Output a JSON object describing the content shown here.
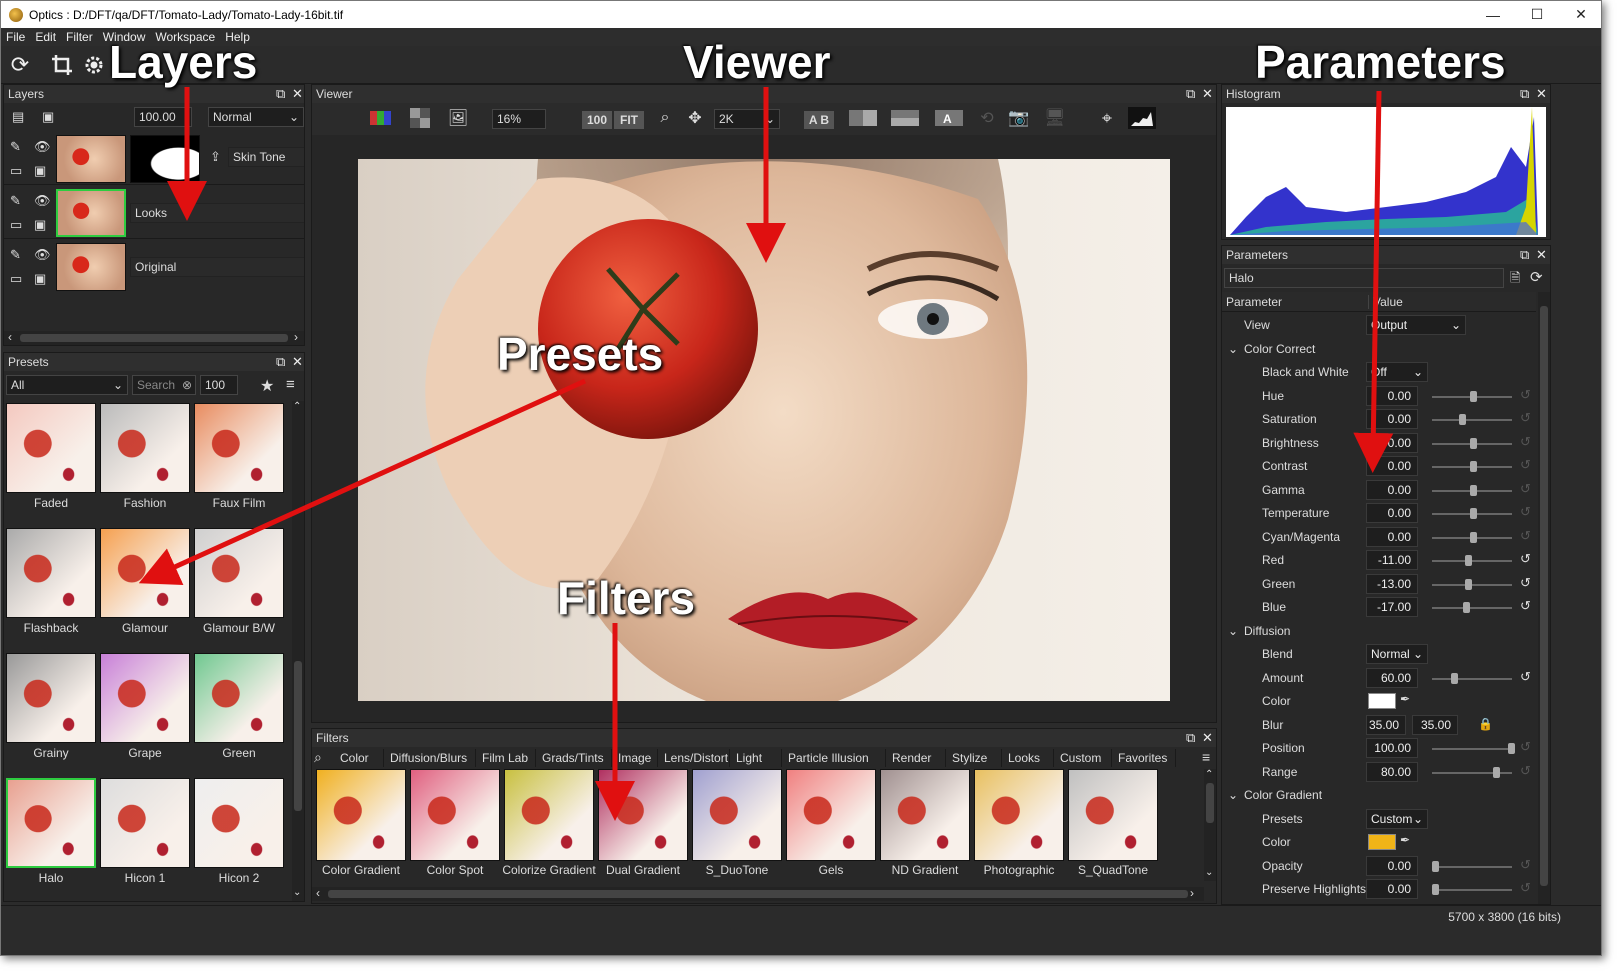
{
  "window": {
    "title": "Optics : D:/DFT/qa/DFT/Tomato-Lady/Tomato-Lady-16bit.tif"
  },
  "menu": [
    "File",
    "Edit",
    "Filter",
    "Window",
    "Workspace",
    "Help"
  ],
  "annotations": {
    "layers": "Layers",
    "viewer": "Viewer",
    "parameters": "Parameters",
    "presets": "Presets",
    "filters": "Filters"
  },
  "layers": {
    "title": "Layers",
    "opacity": "100.00",
    "blend_mode": "Normal",
    "items": [
      {
        "name": "Skin Tone",
        "selected": false
      },
      {
        "name": "Looks",
        "selected": true
      },
      {
        "name": "Original",
        "selected": false
      }
    ]
  },
  "presets": {
    "title": "Presets",
    "category": "All",
    "search_placeholder": "Search",
    "size": "100",
    "items": [
      "Faded",
      "Fashion",
      "Faux Film",
      "Flashback",
      "Glamour",
      "Glamour B/W",
      "Grainy",
      "Grape",
      "Green",
      "Halo",
      "Hicon 1",
      "Hicon 2"
    ],
    "selected": "Halo"
  },
  "viewer": {
    "title": "Viewer",
    "zoom": "16%",
    "btn_100": "100",
    "btn_fit": "FIT",
    "resolution": "2K",
    "btn_ab": "A B"
  },
  "filters": {
    "title": "Filters",
    "tabs": [
      "Color",
      "Diffusion/Blurs",
      "Film Lab",
      "Grads/Tints",
      "Image",
      "Lens/Distort",
      "Light",
      "Particle Illusion",
      "Render",
      "Stylize",
      "Looks",
      "Custom",
      "Favorites"
    ],
    "items": [
      "Color Gradient",
      "Color Spot",
      "Colorize Gradient",
      "Dual Gradient",
      "S_DuoTone",
      "Gels",
      "ND Gradient",
      "Photographic",
      "S_QuadTone"
    ]
  },
  "histogram": {
    "title": "Histogram"
  },
  "parameters": {
    "title": "Parameters",
    "filter_name": "Halo",
    "col_parameter": "Parameter",
    "col_value": "Value",
    "view_label": "View",
    "view_value": "Output",
    "groups": [
      {
        "name": "Color Correct",
        "rows": [
          {
            "name": "Black and White",
            "value": "Off",
            "type": "dropdown"
          },
          {
            "name": "Hue",
            "value": "0.00",
            "pos": 0.5,
            "reset": false
          },
          {
            "name": "Saturation",
            "value": "0.00",
            "pos": 0.35,
            "reset": false
          },
          {
            "name": "Brightness",
            "value": "0.00",
            "pos": 0.5,
            "reset": false
          },
          {
            "name": "Contrast",
            "value": "0.00",
            "pos": 0.5,
            "reset": false
          },
          {
            "name": "Gamma",
            "value": "0.00",
            "pos": 0.5,
            "reset": false
          },
          {
            "name": "Temperature",
            "value": "0.00",
            "pos": 0.5,
            "reset": false
          },
          {
            "name": "Cyan/Magenta",
            "value": "0.00",
            "pos": 0.5,
            "reset": false
          },
          {
            "name": "Red",
            "value": "-11.00",
            "pos": 0.44,
            "reset": true
          },
          {
            "name": "Green",
            "value": "-13.00",
            "pos": 0.43,
            "reset": true
          },
          {
            "name": "Blue",
            "value": "-17.00",
            "pos": 0.41,
            "reset": true
          }
        ]
      },
      {
        "name": "Diffusion",
        "rows": [
          {
            "name": "Blend",
            "value": "Normal",
            "type": "dropdown"
          },
          {
            "name": "Amount",
            "value": "60.00",
            "pos": 0.25,
            "reset": true
          },
          {
            "name": "Color",
            "value": "",
            "type": "color",
            "color": "#ffffff"
          },
          {
            "name": "Blur",
            "value": "35.00",
            "value2": "35.00",
            "type": "pair"
          },
          {
            "name": "Position",
            "value": "100.00",
            "pos": 1.0,
            "reset": false
          },
          {
            "name": "Range",
            "value": "80.00",
            "pos": 0.8,
            "reset": false
          }
        ]
      },
      {
        "name": "Color Gradient",
        "rows": [
          {
            "name": "Presets",
            "value": "Custom",
            "type": "dropdown"
          },
          {
            "name": "Color",
            "value": "",
            "type": "color",
            "color": "#f0b418"
          },
          {
            "name": "Opacity",
            "value": "0.00",
            "pos": 0.0,
            "reset": false
          },
          {
            "name": "Preserve Highlights",
            "value": "0.00",
            "pos": 0.0,
            "reset": false
          }
        ]
      }
    ]
  },
  "status": {
    "dimensions": "5700 x 3800 (16 bits)"
  },
  "colors": {
    "accent_green": "#2ecc40",
    "arrow_red": "#e01010",
    "panel_bg": "#282828"
  }
}
